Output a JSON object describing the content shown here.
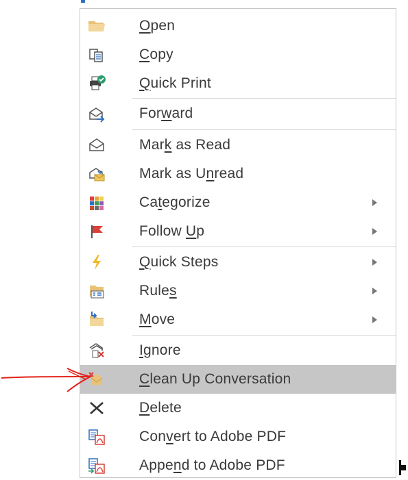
{
  "colors": {
    "highlight": "#c6c6c6",
    "annotation": "#e2231a",
    "text": "#3a3a3a"
  },
  "menu": {
    "items": [
      {
        "pre": "",
        "key": "O",
        "post": "pen",
        "icon": "folder-open-icon"
      },
      {
        "pre": "",
        "key": "C",
        "post": "opy",
        "icon": "copy-icon"
      },
      {
        "pre": "",
        "key": "Q",
        "post": "uick Print",
        "icon": "quick-print-icon"
      },
      {
        "pre": "For",
        "key": "w",
        "post": "ard",
        "icon": "forward-icon"
      },
      {
        "pre": "Mar",
        "key": "k",
        "post": " as Read",
        "icon": "mark-read-icon"
      },
      {
        "pre": "Mark as U",
        "key": "n",
        "post": "read",
        "icon": "mark-unread-icon"
      },
      {
        "pre": "Ca",
        "key": "t",
        "post": "egorize",
        "icon": "categorize-icon"
      },
      {
        "pre": "Follow ",
        "key": "U",
        "post": "p",
        "icon": "follow-up-flag-icon"
      },
      {
        "pre": "",
        "key": "Q",
        "post": "uick Steps",
        "icon": "quick-steps-icon"
      },
      {
        "pre": "Rule",
        "key": "s",
        "post": "",
        "icon": "rules-icon"
      },
      {
        "pre": "",
        "key": "M",
        "post": "ove",
        "icon": "move-icon"
      },
      {
        "pre": "",
        "key": "I",
        "post": "gnore",
        "icon": "ignore-icon"
      },
      {
        "pre": "",
        "key": "C",
        "post": "lean Up Conversation",
        "icon": "clean-up-icon"
      },
      {
        "pre": "",
        "key": "D",
        "post": "elete",
        "icon": "delete-icon"
      },
      {
        "pre": "Con",
        "key": "v",
        "post": "ert to Adobe PDF",
        "icon": "convert-pdf-icon"
      },
      {
        "pre": "Appe",
        "key": "n",
        "post": "d to Adobe PDF",
        "icon": "append-pdf-icon"
      }
    ]
  }
}
